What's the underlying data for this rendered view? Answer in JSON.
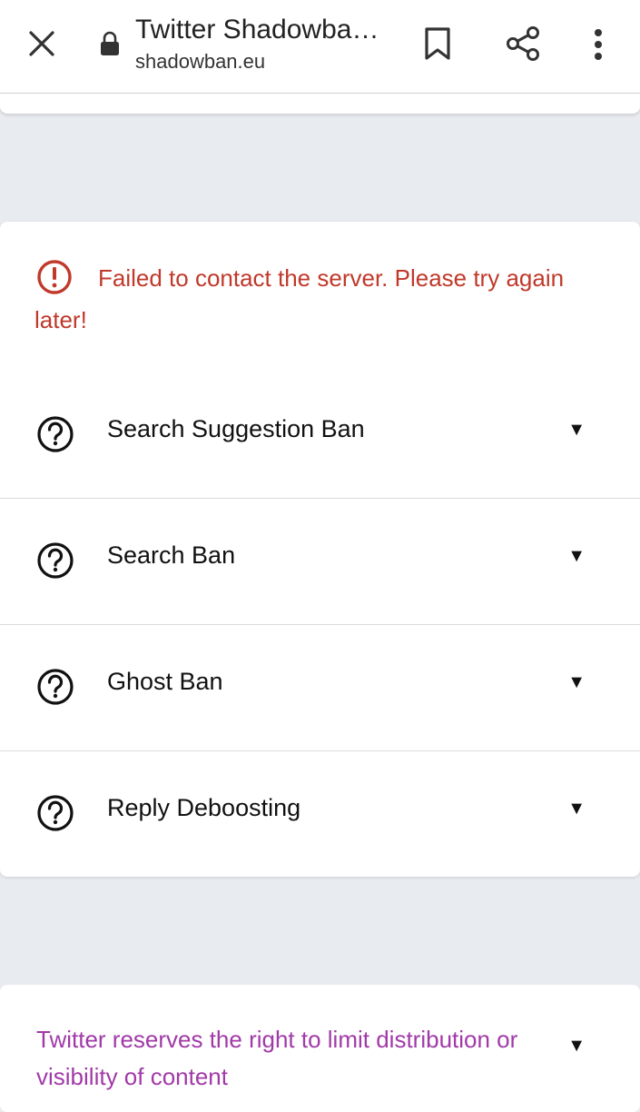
{
  "browser": {
    "page_title": "Twitter Shadowba…",
    "url": "shadowban.eu"
  },
  "icons": {
    "close": "close-icon",
    "lock": "lock-icon",
    "bookmark": "bookmark-icon",
    "share": "share-icon",
    "menu": "more-vert-icon",
    "error": "error-circle-icon",
    "help": "help-circle-icon",
    "caret": "caret-down-icon"
  },
  "colors": {
    "error": "#c0392b",
    "note": "#a13aa8",
    "background": "#e8ebef"
  },
  "error_message": "Failed to contact the server. Please try again later!",
  "checks": [
    {
      "label": "Search Suggestion Ban",
      "caret": "▼"
    },
    {
      "label": "Search Ban",
      "caret": "▼"
    },
    {
      "label": "Ghost Ban",
      "caret": "▼"
    },
    {
      "label": "Reply Deboosting",
      "caret": "▼"
    }
  ],
  "footer_note": {
    "text": "Twitter reserves the right to limit distribution or visibility of content",
    "caret": "▼"
  }
}
